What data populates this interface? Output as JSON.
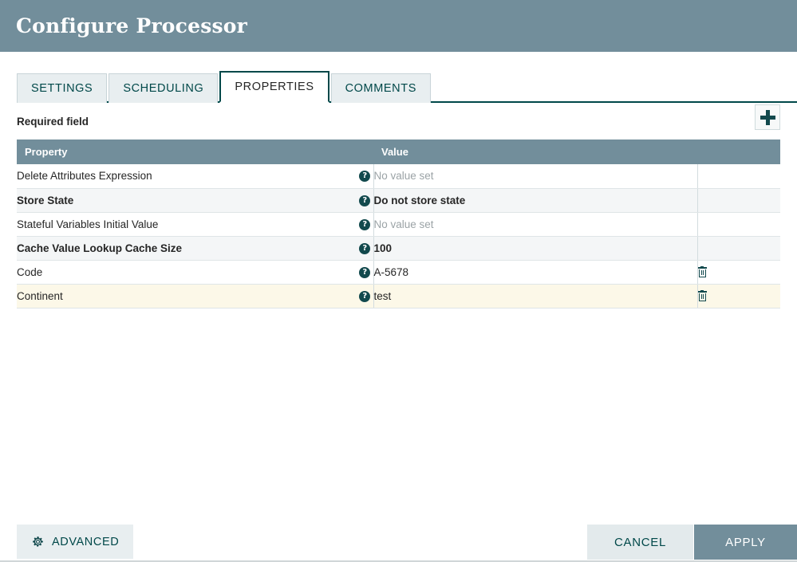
{
  "window": {
    "title": "Configure Processor"
  },
  "tabs": [
    {
      "label": "SETTINGS",
      "active": false
    },
    {
      "label": "SCHEDULING",
      "active": false
    },
    {
      "label": "PROPERTIES",
      "active": true
    },
    {
      "label": "COMMENTS",
      "active": false
    }
  ],
  "toolbar": {
    "required_field_label": "Required field",
    "add_icon": "plus-icon"
  },
  "table": {
    "columns": [
      "Property",
      "Value"
    ],
    "rows": [
      {
        "property": "Delete Attributes Expression",
        "value": "No value set",
        "value_unset": true,
        "required": false,
        "deletable": false,
        "highlighted": false
      },
      {
        "property": "Store State",
        "value": "Do not store state",
        "value_unset": false,
        "required": true,
        "deletable": false,
        "highlighted": false
      },
      {
        "property": "Stateful Variables Initial Value",
        "value": "No value set",
        "value_unset": true,
        "required": false,
        "deletable": false,
        "highlighted": false
      },
      {
        "property": "Cache Value Lookup Cache Size",
        "value": "100",
        "value_unset": false,
        "required": true,
        "deletable": false,
        "highlighted": false
      },
      {
        "property": "Code",
        "value": "A-5678",
        "value_unset": false,
        "required": false,
        "deletable": true,
        "highlighted": false
      },
      {
        "property": "Continent",
        "value": "test",
        "value_unset": false,
        "required": false,
        "deletable": true,
        "highlighted": true
      }
    ],
    "help_icon": "help-circle-icon",
    "delete_icon": "trash-icon"
  },
  "footer": {
    "advanced_label": "ADVANCED",
    "advanced_icon": "gear-icon",
    "cancel_label": "CANCEL",
    "apply_label": "APPLY"
  },
  "colors": {
    "header_bar": "#728e9b",
    "accent_teal": "#004849",
    "tab_inactive": "#e8eef0",
    "row_alt": "#f4f6f7",
    "row_highlight": "#fcf8e8",
    "apply_button": "#728e9b"
  }
}
